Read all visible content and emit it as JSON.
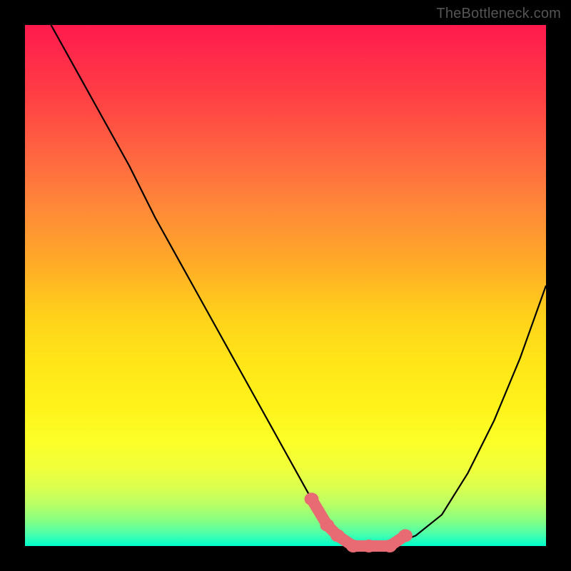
{
  "watermark": "TheBottleneck.com",
  "chart_data": {
    "type": "line",
    "title": "",
    "xlabel": "",
    "ylabel": "",
    "xlim": [
      0,
      100
    ],
    "ylim": [
      0,
      100
    ],
    "series": [
      {
        "name": "bottleneck-curve",
        "x": [
          5,
          10,
          15,
          20,
          25,
          30,
          35,
          40,
          45,
          50,
          55,
          58,
          60,
          63,
          66,
          70,
          75,
          80,
          85,
          90,
          95,
          100
        ],
        "values": [
          100,
          91,
          82,
          73,
          63,
          54,
          45,
          36,
          27,
          18,
          9,
          4,
          2,
          0,
          0,
          0,
          2,
          6,
          14,
          24,
          36,
          50
        ]
      }
    ],
    "markers": {
      "name": "highlight-segment",
      "x": [
        55,
        58,
        60,
        63,
        66,
        70,
        73
      ],
      "values": [
        9,
        4,
        2,
        0,
        0,
        0,
        2
      ]
    },
    "grid": false,
    "legend": false,
    "background_gradient": [
      "#ff1a4d",
      "#ffd21a",
      "#fff21a",
      "#00ffcc"
    ]
  }
}
